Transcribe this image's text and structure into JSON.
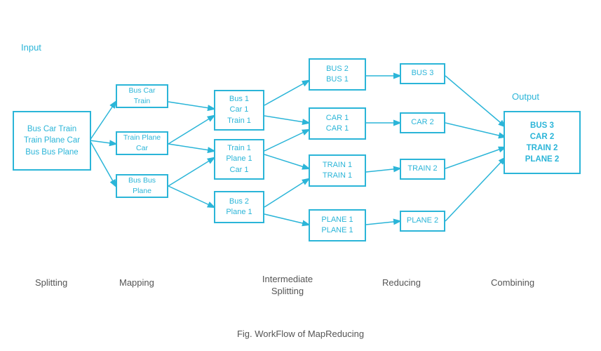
{
  "title": "Fig. WorkFlow of MapReducing",
  "labels": {
    "input": "Input",
    "output": "Output",
    "splitting": "Splitting",
    "mapping": "Mapping",
    "intermediate_splitting": "Intermediate\nSplitting",
    "reducing": "Reducing",
    "combining": "Combining"
  },
  "boxes": {
    "input": "Bus Car Train\nTrain Plane Car\nBus Bus Plane",
    "map1": "Bus Car Train",
    "map2": "Train Plane Car",
    "map3": "Bus Bus Plane",
    "split1": "Bus 1\nCar 1\nTrain 1",
    "split2": "Train 1\nPlane 1\nCar 1",
    "split3": "Bus 2\nPlane 1",
    "inter1": "BUS 2\nBUS 1",
    "inter2": "CAR 1\nCAR 1",
    "inter3": "TRAIN 1\nTRAIN 1",
    "inter4": "PLANE 1\nPLANE 1",
    "reduce1": "BUS 3",
    "reduce2": "CAR 2",
    "reduce3": "TRAIN 2",
    "reduce4": "PLANE 2",
    "output": "BUS 3\nCAR 2\nTRAIN 2\nPLANE 2"
  }
}
